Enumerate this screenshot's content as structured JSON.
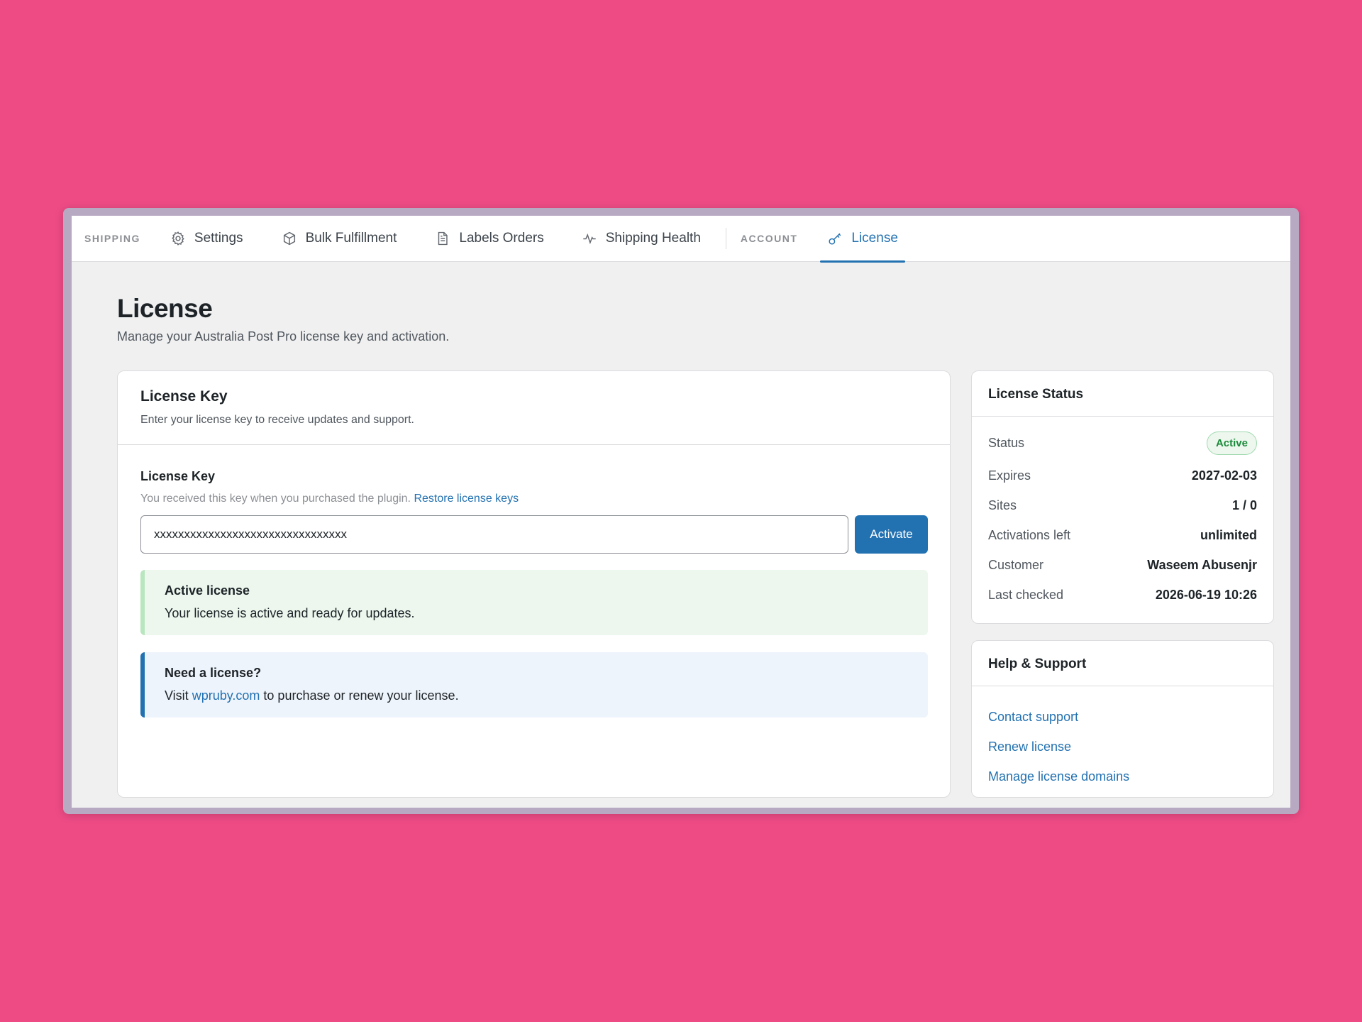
{
  "nav": {
    "group_shipping": "SHIPPING",
    "group_account": "ACCOUNT",
    "items": [
      {
        "label": "Settings",
        "icon": "gear-icon"
      },
      {
        "label": "Bulk Fulfillment",
        "icon": "box-icon"
      },
      {
        "label": "Labels Orders",
        "icon": "document-icon"
      },
      {
        "label": "Shipping Health",
        "icon": "pulse-icon"
      },
      {
        "label": "License",
        "icon": "key-icon",
        "active": true
      }
    ]
  },
  "page": {
    "title": "License",
    "subtitle": "Manage your Australia Post Pro license key and activation."
  },
  "license_card": {
    "title": "License Key",
    "description": "Enter your license key to receive updates and support.",
    "field_label": "License Key",
    "help_text": "You received this key when you purchased the plugin.",
    "restore_link": "Restore license keys",
    "key_value": "xxxxxxxxxxxxxxxxxxxxxxxxxxxxxxxx",
    "activate_label": "Activate",
    "success_notice": {
      "title": "Active license",
      "body": "Your license is active and ready for updates."
    },
    "info_notice": {
      "title": "Need a license?",
      "body_prefix": "Visit",
      "link": "wpruby.com",
      "body_suffix": "to purchase or renew your license."
    }
  },
  "status_card": {
    "title": "License Status",
    "status_label": "Status",
    "status_value": "Active",
    "rows": [
      {
        "key": "Expires",
        "value": "2027-02-03"
      },
      {
        "key": "Sites",
        "value": "1 / 0"
      },
      {
        "key": "Activations left",
        "value": "unlimited"
      },
      {
        "key": "Customer",
        "value": "Waseem Abusenjr"
      },
      {
        "key": "Last checked",
        "value": "2026-06-19 10:26"
      }
    ]
  },
  "help_card": {
    "title": "Help & Support",
    "links": [
      "Contact support",
      "Renew license",
      "Manage license domains"
    ]
  },
  "colors": {
    "background": "#ee4b85",
    "accent": "#2271b1",
    "success": "#1a8a3a"
  }
}
